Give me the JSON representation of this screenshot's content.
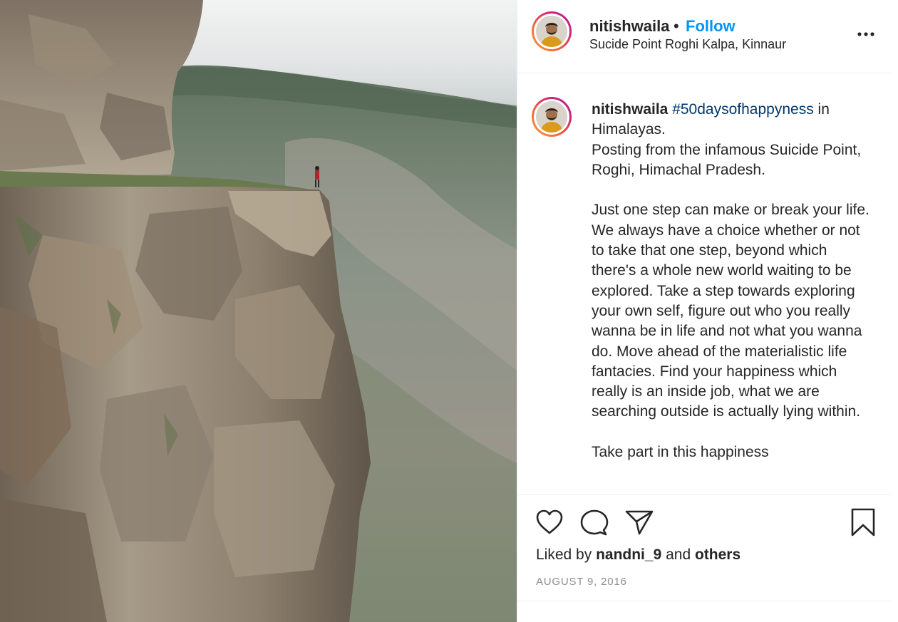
{
  "header": {
    "username": "nitishwaila",
    "separator": "•",
    "follow_label": "Follow",
    "location": "Sucide Point Roghi Kalpa, Kinnaur",
    "more_icon": "more-horizontal-icon"
  },
  "caption": {
    "username": "nitishwaila",
    "hashtag": "#50daysofhappyness",
    "text": " in Himalayas.\nPosting from the infamous Suicide Point, Roghi, Himachal Pradesh.\n\nJust one step can make or break your life. We always have a choice whether or not to take that one step, beyond which there's a whole new world waiting to be explored. Take a step towards exploring your own self, figure out who you really wanna be in life and not what you wanna do. Move ahead of the materialistic life fantacies. Find your happiness which really is an inside job, what we are searching outside is actually lying within.\n\nTake part in this happiness"
  },
  "actions": {
    "like_icon": "heart-icon",
    "comment_icon": "comment-icon",
    "share_icon": "paper-plane-icon",
    "save_icon": "bookmark-icon"
  },
  "likes": {
    "prefix": "Liked by ",
    "user": "nandni_9",
    "middle": " and ",
    "others": "others"
  },
  "date": "AUGUST 9, 2016",
  "colors": {
    "follow": "#0095f6",
    "hashtag": "#00376b",
    "text": "#262626",
    "muted": "#8e8e8e",
    "border": "#efefef"
  }
}
